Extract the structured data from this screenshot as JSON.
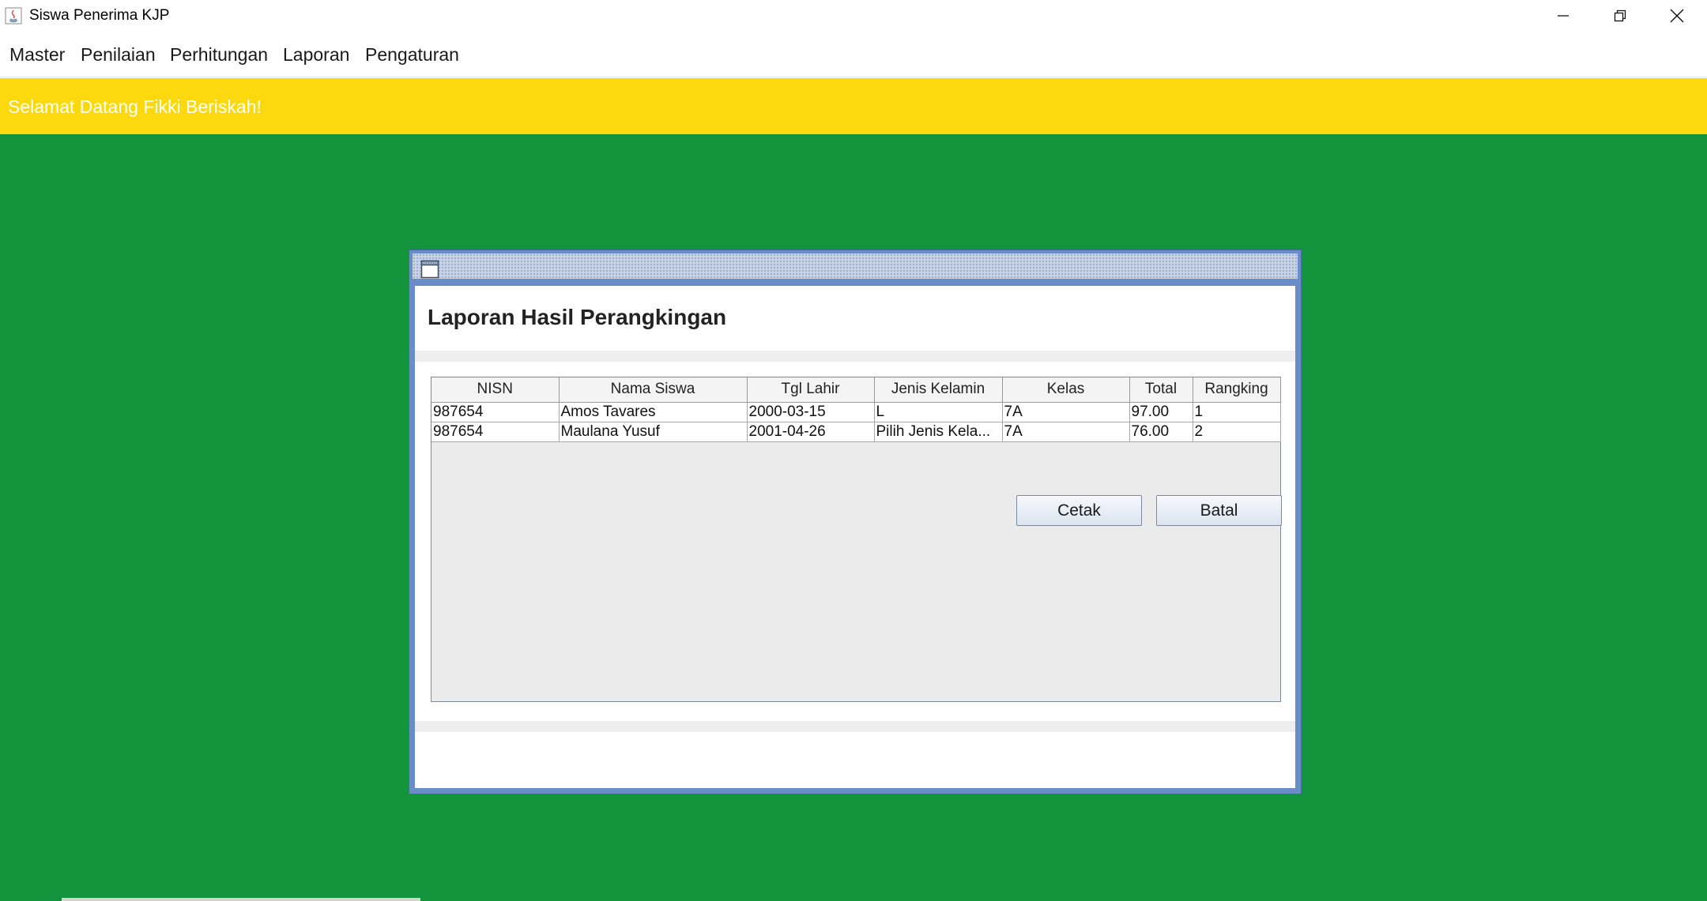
{
  "window": {
    "title": "Siswa Penerima KJP"
  },
  "menu": {
    "items": [
      {
        "label": "Master"
      },
      {
        "label": "Penilaian"
      },
      {
        "label": "Perhitungan"
      },
      {
        "label": "Laporan"
      },
      {
        "label": "Pengaturan"
      }
    ]
  },
  "banner": {
    "text": "Selamat Datang Fikki Beriskah!",
    "color": "#fcd90f"
  },
  "desktop": {
    "color": "#13933b"
  },
  "report": {
    "title": "Laporan Hasil Perangkingan",
    "columns": [
      "NISN",
      "Nama Siswa",
      "Tgl Lahir",
      "Jenis Kelamin",
      "Kelas",
      "Total",
      "Rangking"
    ],
    "rows": [
      [
        "987654",
        "Amos Tavares",
        "2000-03-15",
        "L",
        "7A",
        "97.00",
        "1"
      ],
      [
        "987654",
        "Maulana Yusuf",
        "2001-04-26",
        "Pilih Jenis Kela...",
        "7A",
        "76.00",
        "2"
      ]
    ],
    "buttons": {
      "print": "Cetak",
      "cancel": "Batal"
    }
  }
}
